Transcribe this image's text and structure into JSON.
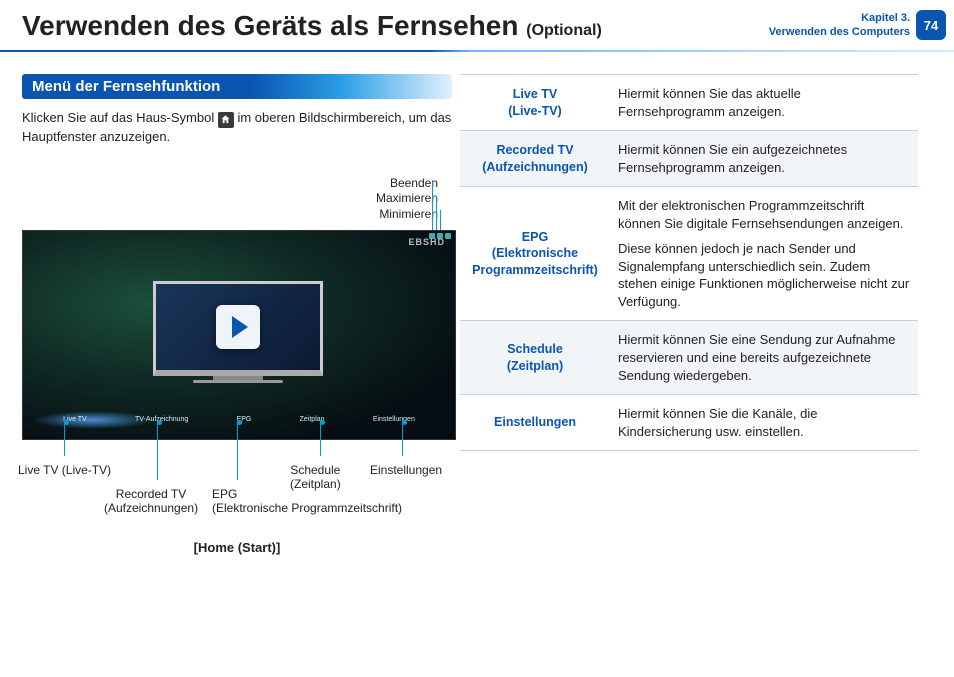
{
  "header": {
    "title": "Verwenden des Geräts als Fernsehen",
    "optional": "(Optional)",
    "chapter_line1": "Kapitel 3.",
    "chapter_line2": "Verwenden des Computers",
    "page_number": "74"
  },
  "section_title": "Menü der Fernsehfunktion",
  "intro_part1": "Klicken Sie auf das Haus-Symbol ",
  "intro_part2": " im oberen Bildschirmbereich, um das Hauptfenster anzuzeigen.",
  "top_callouts": {
    "close": "Beenden",
    "maximize": "Maximieren",
    "minimize": "Minimieren"
  },
  "screenshot": {
    "channel_logo": "EBSHD",
    "menu": {
      "live": "Live TV",
      "recorded": "TV-Aufzeichnung",
      "epg": "EPG",
      "schedule": "Zeitplan",
      "settings": "Einstellungen"
    }
  },
  "bottom_callouts": {
    "live": "Live TV (Live-TV)",
    "recorded_l1": "Recorded TV",
    "recorded_l2": "(Aufzeichnungen)",
    "epg_l1": "EPG",
    "epg_l2": "(Elektronische Programmzeitschrift)",
    "schedule_l1": "Schedule",
    "schedule_l2": "(Zeitplan)",
    "settings": "Einstellungen"
  },
  "caption": "[Home (Start)]",
  "table": [
    {
      "label_l1": "Live TV",
      "label_l2": "(Live-TV)",
      "desc": "Hiermit können Sie das aktuelle Fernsehprogramm anzeigen."
    },
    {
      "label_l1": "Recorded TV",
      "label_l2": "(Aufzeichnungen)",
      "desc": "Hiermit können Sie ein aufgezeichnetes Fernsehprogramm anzeigen."
    },
    {
      "label_l1": "EPG",
      "label_l2": "(Elektronische",
      "label_l3": "Programmzeitschrift)",
      "desc_p1": "Mit der elektronischen Programmzeitschrift können Sie digitale Fernsehsendungen anzeigen.",
      "desc_p2": "Diese können jedoch je nach Sender und Signalempfang unterschiedlich sein. Zudem stehen einige Funktionen möglicherweise nicht zur Verfügung."
    },
    {
      "label_l1": "Schedule",
      "label_l2": "(Zeitplan)",
      "desc": "Hiermit können Sie eine Sendung zur Aufnahme reservieren und eine bereits aufgezeichnete Sendung wiedergeben."
    },
    {
      "label_l1": "Einstellungen",
      "desc": "Hiermit können Sie die Kanäle, die Kindersicherung usw. einstellen."
    }
  ]
}
